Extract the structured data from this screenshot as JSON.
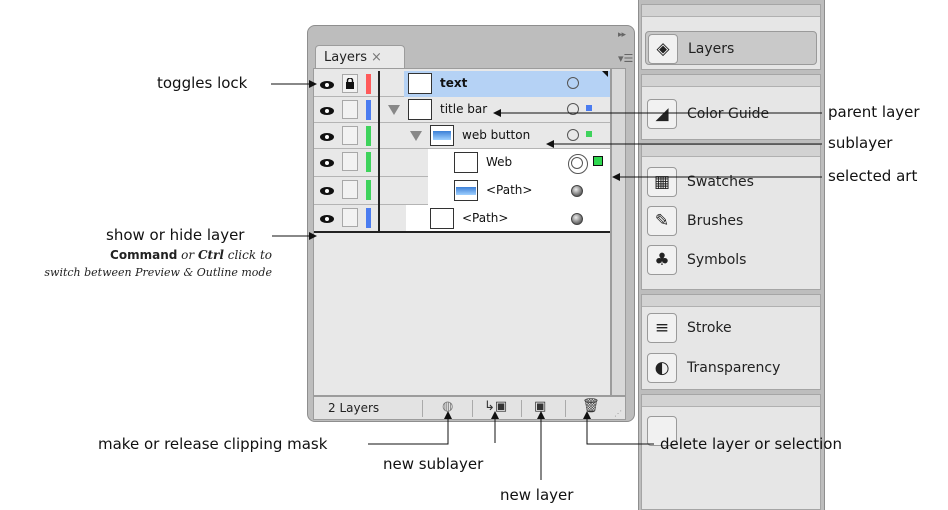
{
  "panel": {
    "tab_label": "Layers",
    "tab_close": "×",
    "footer_count": "2 Layers",
    "rows": [
      {
        "name": "text",
        "bold": true,
        "locked": true,
        "color": "#ff5a5a",
        "selected": true,
        "target": "empty"
      },
      {
        "name": "title bar",
        "bold": false,
        "locked": false,
        "color": "#4a7cf0",
        "selected": false,
        "target": "empty",
        "sel_color": "#4a7cf0"
      },
      {
        "name": "web button",
        "bold": false,
        "locked": false,
        "color": "#3ed35c",
        "selected": false,
        "target": "empty",
        "sel_color": "#3ed35c"
      },
      {
        "name": "Web",
        "bold": false,
        "locked": false,
        "color": "#3ed35c",
        "selected": false,
        "target": "double"
      },
      {
        "name": "<Path>",
        "bold": false,
        "locked": false,
        "color": "#3ed35c",
        "selected": false,
        "target": "filled"
      },
      {
        "name": "<Path>",
        "bold": false,
        "locked": false,
        "color": "#4a7cf0",
        "selected": false,
        "target": "filled"
      }
    ]
  },
  "dock": {
    "items": [
      {
        "label": "Layers",
        "icon": "layers-icon",
        "glyph": "◈"
      },
      {
        "label": "Color Guide",
        "icon": "color-guide-icon",
        "glyph": "◢"
      },
      {
        "label": "Swatches",
        "icon": "swatches-icon",
        "glyph": "▦"
      },
      {
        "label": "Brushes",
        "icon": "brushes-icon",
        "glyph": "✎"
      },
      {
        "label": "Symbols",
        "icon": "symbols-icon",
        "glyph": "♣"
      },
      {
        "label": "Stroke",
        "icon": "stroke-icon",
        "glyph": "≡"
      },
      {
        "label": "Transparency",
        "icon": "transparency-icon",
        "glyph": "◐"
      }
    ]
  },
  "callouts": {
    "toggles_lock": "toggles lock",
    "show_hide": "show or hide layer",
    "note_cmd": "Command",
    "note_or": " or ",
    "note_ctrl": "Ctrl",
    "note_click": " click to",
    "note_line2": "switch between Preview & Outline mode",
    "parent_layer": "parent layer",
    "sublayer": "sublayer",
    "selected_art": "selected art",
    "clipping_mask": "make or release clipping mask",
    "new_sublayer": "new sublayer",
    "new_layer": "new layer",
    "delete": "delete layer or selection"
  },
  "colors": {
    "selected_row": "#b5d2f5",
    "selected_art": "#2fd84f"
  }
}
